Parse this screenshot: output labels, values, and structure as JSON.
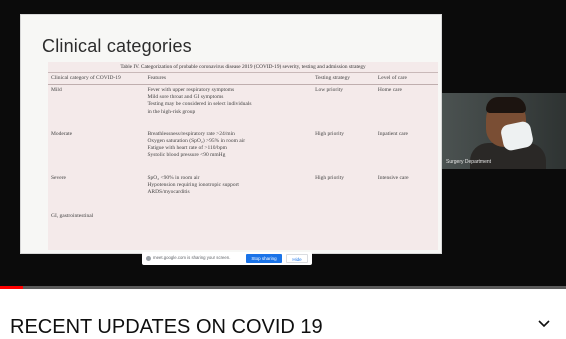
{
  "slide": {
    "title": "Clinical categories",
    "table_caption": "Table IV. Categorization of probable coronavirus disease 2019 (COVID-19) severity, testing and admission strategy",
    "columns": [
      "Clinical category of COVID-19",
      "Features",
      "Testing strategy",
      "Level of care"
    ],
    "rows": [
      {
        "category": "Mild",
        "features": [
          "Fever with upper respiratory symptoms",
          "Mild sore throat and GI symptoms",
          "Testing may be considered in select individuals",
          "in the high-risk group"
        ],
        "testing": "Low priority",
        "care": "Home care"
      },
      {
        "category": "Moderate",
        "features": [
          "Breathlessness/respiratory rate >24/min",
          "Oxygen saturation (SpO₂) >95% in room air",
          "Fatigue with heart rate of >110/bpm",
          "Systolic blood pressure <90 mmHg"
        ],
        "testing": "High priority",
        "care": "Inpatient care"
      },
      {
        "category": "Severe",
        "features": [
          "SpO₂ <90% in room air",
          "Hypotension requiring ionotropic support",
          "ARDS/myocarditis"
        ],
        "testing": "High priority",
        "care": "Intensive care"
      },
      {
        "category": "GI, gastrointestinal",
        "features": [],
        "testing": "",
        "care": ""
      }
    ]
  },
  "webcam": {
    "label": "Surgery Department"
  },
  "share_bar": {
    "text": "meet.google.com is sharing your screen.",
    "stop_label": "Stop sharing",
    "hide_label": "Hide"
  },
  "playback": {
    "progress": 0.04,
    "accent": "#ff0000"
  },
  "video": {
    "title": "RECENT UPDATES ON COVID 19"
  },
  "icons": {
    "expand": "chevron-down-icon"
  }
}
